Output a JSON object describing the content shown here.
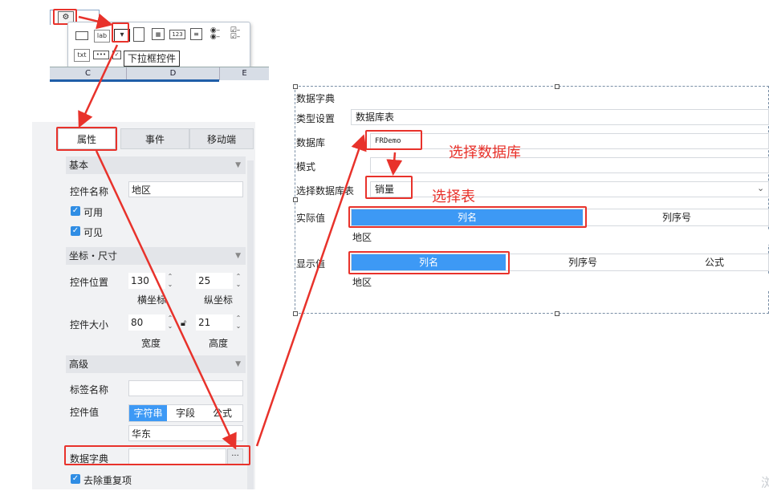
{
  "toolbar": {
    "icons": [
      "wrench-icon"
    ],
    "buttons_row1": [
      "",
      "lab",
      "▾",
      "",
      "",
      "123",
      "",
      "",
      ""
    ],
    "buttons_row2": [
      "txt",
      "•••",
      ""
    ],
    "tooltip": "下拉框控件",
    "columns": [
      "C",
      "D",
      "E"
    ]
  },
  "panel": {
    "tabs": [
      "属性",
      "事件",
      "移动端"
    ],
    "sections": {
      "basic": "基本",
      "coords": "坐标・尺寸",
      "advanced": "高级"
    },
    "widget_name_label": "控件名称",
    "widget_name_value": "地区",
    "enabled_label": "可用",
    "visible_label": "可见",
    "position_label": "控件位置",
    "pos_x": "130",
    "pos_y": "25",
    "x_caption": "横坐标",
    "y_caption": "纵坐标",
    "size_label": "控件大小",
    "width": "80",
    "height": "21",
    "width_caption": "宽度",
    "height_caption": "高度",
    "tag_name_label": "标签名称",
    "tag_name_value": "",
    "widget_value_label": "控件值",
    "value_types": [
      "字符串",
      "字段",
      "公式"
    ],
    "widget_value": "华东",
    "dict_label": "数据字典",
    "dict_btn": "···",
    "dedupe_label": "去除重复项"
  },
  "form": {
    "title": "数据字典",
    "type_label": "类型设置",
    "type_value": "数据库表",
    "db_label": "数据库",
    "db_value": "FRDemo",
    "mode_label": "模式",
    "table_label": "选择数据库表",
    "table_value": "销量",
    "actual_label": "实际值",
    "actual_options": [
      "列名",
      "列序号"
    ],
    "actual_value": "地区",
    "display_label": "显示值",
    "display_options": [
      "列名",
      "列序号",
      "公式"
    ],
    "display_value": "地区"
  },
  "annotations": {
    "select_db": "选择数据库",
    "select_table": "选择表"
  },
  "watermark": "浏",
  "colors": {
    "annotation_red": "#e8322b",
    "selected_blue": "#3d99f5",
    "checkbox_blue": "#2f8de4"
  }
}
